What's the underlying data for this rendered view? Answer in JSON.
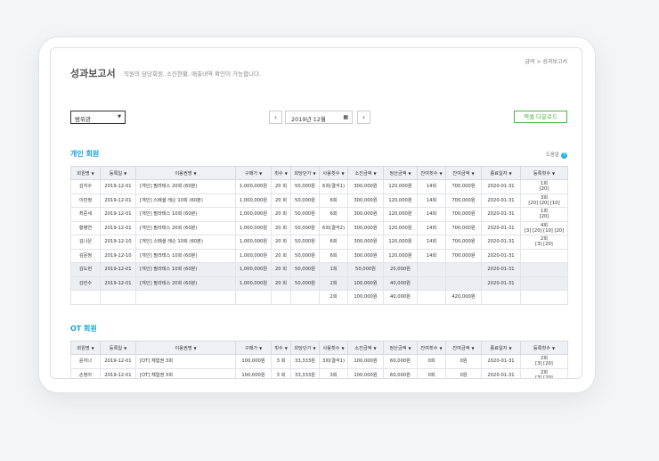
{
  "breadcrumb": "급여 > 성과보고서",
  "page": {
    "title": "성과보고서",
    "description": "직원의 담당회원, 소진현황, 매출내역 확인이 가능합니다."
  },
  "filter": {
    "selected": "범위관",
    "date": "2019년 12월",
    "excel_button": "엑셀 다운로드"
  },
  "help_label": "도움말",
  "columns": [
    "회원명",
    "등록일",
    "이용권명",
    "구매가",
    "횟수",
    "회당단가",
    "사용횟수",
    "소진금액",
    "정산금액",
    "잔여횟수",
    "잔여금액",
    "종료일자",
    "등록횟수"
  ],
  "personal": {
    "title": "개인 회원",
    "rows": [
      {
        "name": "김지수",
        "date": "2019-12-01",
        "pass": "[개인] 필라테스 20회 (60분)",
        "price": "1,000,000원",
        "count": "20 회",
        "unit": "50,000원",
        "used": "6회(결석1)",
        "spent": "300,000원",
        "settle": "120,000원",
        "remain": "14회",
        "remain_amt": "700,000원",
        "end": "2020-01-31",
        "reg1": "1회",
        "reg2": "[20]",
        "gray": false
      },
      {
        "name": "이민정",
        "date": "2019-12-01",
        "pass": "[개인] 스페셜 레슨 10회 (60분)",
        "price": "1,000,000원",
        "count": "20 회",
        "unit": "50,000원",
        "used": "6회",
        "spent": "300,000원",
        "settle": "120,000원",
        "remain": "14회",
        "remain_amt": "700,000원",
        "end": "2020-01-31",
        "reg1": "3회",
        "reg2": "[20] [20] [10]",
        "gray": false
      },
      {
        "name": "최준세",
        "date": "2019-12-01",
        "pass": "[개인] 필라테스 10회 (60분)",
        "price": "1,000,000원",
        "count": "20 회",
        "unit": "50,000원",
        "used": "6회",
        "spent": "300,000원",
        "settle": "120,000원",
        "remain": "14회",
        "remain_amt": "700,000원",
        "end": "2020-01-31",
        "reg1": "1회",
        "reg2": "[20]",
        "gray": false
      },
      {
        "name": "황병연",
        "date": "2019-12-01",
        "pass": "[개인] 필라테스 20회 (60분)",
        "price": "1,000,000원",
        "count": "20 회",
        "unit": "50,000원",
        "used": "6회(결석2)",
        "spent": "300,000원",
        "settle": "120,000원",
        "remain": "14회",
        "remain_amt": "700,000원",
        "end": "2020-01-31",
        "reg1": "4회",
        "reg2": "[3] [20] [10] [20]",
        "gray": false
      },
      {
        "name": "김나은",
        "date": "2019-12-10",
        "pass": "[개인] 스페셜 레슨 10회 (60분)",
        "price": "1,000,000원",
        "count": "20 회",
        "unit": "50,000원",
        "used": "6회",
        "spent": "300,000원",
        "settle": "120,000원",
        "remain": "14회",
        "remain_amt": "700,000원",
        "end": "2020-01-31",
        "reg1": "2회",
        "reg2": "[3] [20]",
        "gray": false
      },
      {
        "name": "김문정",
        "date": "2019-12-10",
        "pass": "[개인] 필라테스 10회 (60분)",
        "price": "1,000,000원",
        "count": "20 회",
        "unit": "50,000원",
        "used": "6회",
        "spent": "300,000원",
        "settle": "120,000원",
        "remain": "14회",
        "remain_amt": "700,000원",
        "end": "2020-01-31",
        "reg1": "",
        "reg2": "",
        "gray": false
      },
      {
        "name": "김도현",
        "date": "2019-12-01",
        "pass": "[개인] 필라테스 10회 (60분)",
        "price": "1,000,000원",
        "count": "20 회",
        "unit": "50,000원",
        "used": "1회",
        "spent": "50,000원",
        "settle": "20,000원",
        "remain": "",
        "remain_amt": "",
        "end": "2020-01-31",
        "reg1": "",
        "reg2": "",
        "gray": true
      },
      {
        "name": "강민수",
        "date": "2019-12-01",
        "pass": "[개인] 필라테스 20회 (60분)",
        "price": "1,000,000원",
        "count": "20 회",
        "unit": "50,000원",
        "used": "2회",
        "spent": "100,000원",
        "settle": "40,000원",
        "remain": "",
        "remain_amt": "",
        "end": "2020-01-31",
        "reg1": "",
        "reg2": "",
        "gray": true
      }
    ],
    "total": {
      "used": "2회",
      "spent": "100,000원",
      "settle": "40,000원",
      "remain_amt": "420,000원"
    }
  },
  "ot": {
    "title": "OT 회원",
    "rows": [
      {
        "name": "윤지나",
        "date": "2019-12-01",
        "pass": "[OT] 체험권 3회",
        "price": "100,000원",
        "count": "3 회",
        "unit": "33,333원",
        "used": "3회(결석1)",
        "spent": "100,000원",
        "settle": "60,000원",
        "remain": "0회",
        "remain_amt": "0원",
        "end": "2020-01-31",
        "reg1": "2회",
        "reg2": "[3] [20]",
        "gray": false
      },
      {
        "name": "손정아",
        "date": "2019-12-01",
        "pass": "[OT] 체험권 3회",
        "price": "100,000원",
        "count": "3 회",
        "unit": "33,333원",
        "used": "3회",
        "spent": "100,000원",
        "settle": "60,000원",
        "remain": "0회",
        "remain_amt": "0원",
        "end": "2020-01-31",
        "reg1": "2회",
        "reg2": "[3] [20]",
        "gray": false
      }
    ]
  }
}
